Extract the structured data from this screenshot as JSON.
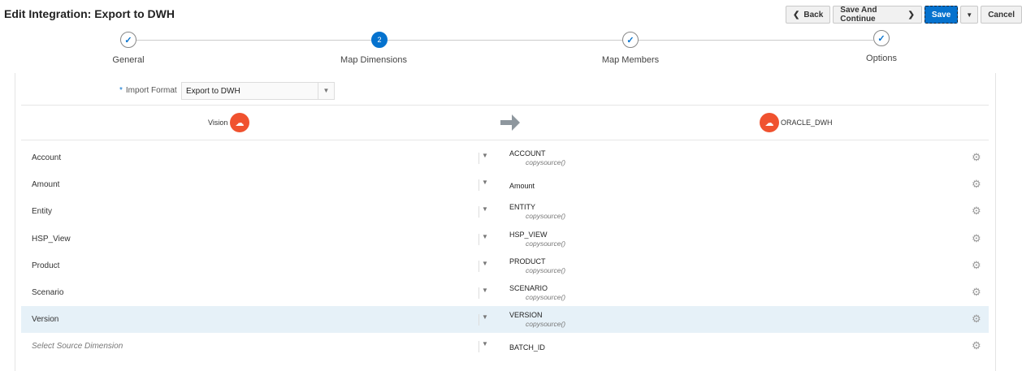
{
  "title": "Edit Integration: Export to DWH",
  "buttons": {
    "back": "Back",
    "save_continue": "Save And Continue",
    "save": "Save",
    "cancel": "Cancel"
  },
  "steps": [
    {
      "label": "General",
      "state": "done"
    },
    {
      "label": "Map Dimensions",
      "state": "current",
      "number": "2"
    },
    {
      "label": "Map Members",
      "state": "done"
    },
    {
      "label": "Options",
      "state": "done"
    }
  ],
  "import_format": {
    "label": "Import Format",
    "value": "Export to DWH"
  },
  "source_app": "Vision",
  "target_app": "ORACLE_DWH",
  "rows": [
    {
      "source": "Account",
      "target": "ACCOUNT",
      "expression": "copysource()"
    },
    {
      "source": "Amount",
      "target": "Amount",
      "expression": ""
    },
    {
      "source": "Entity",
      "target": "ENTITY",
      "expression": "copysource()"
    },
    {
      "source": "HSP_View",
      "target": "HSP_VIEW",
      "expression": "copysource()"
    },
    {
      "source": "Product",
      "target": "PRODUCT",
      "expression": "copysource()"
    },
    {
      "source": "Scenario",
      "target": "SCENARIO",
      "expression": "copysource()"
    },
    {
      "source": "Version",
      "target": "VERSION",
      "expression": "copysource()"
    },
    {
      "source": "",
      "placeholder": "Select Source Dimension",
      "target": "BATCH_ID",
      "expression": ""
    }
  ],
  "colors": {
    "accent": "#0572ce",
    "logo": "#f0522f",
    "selected_row": "#e6f1f8"
  }
}
